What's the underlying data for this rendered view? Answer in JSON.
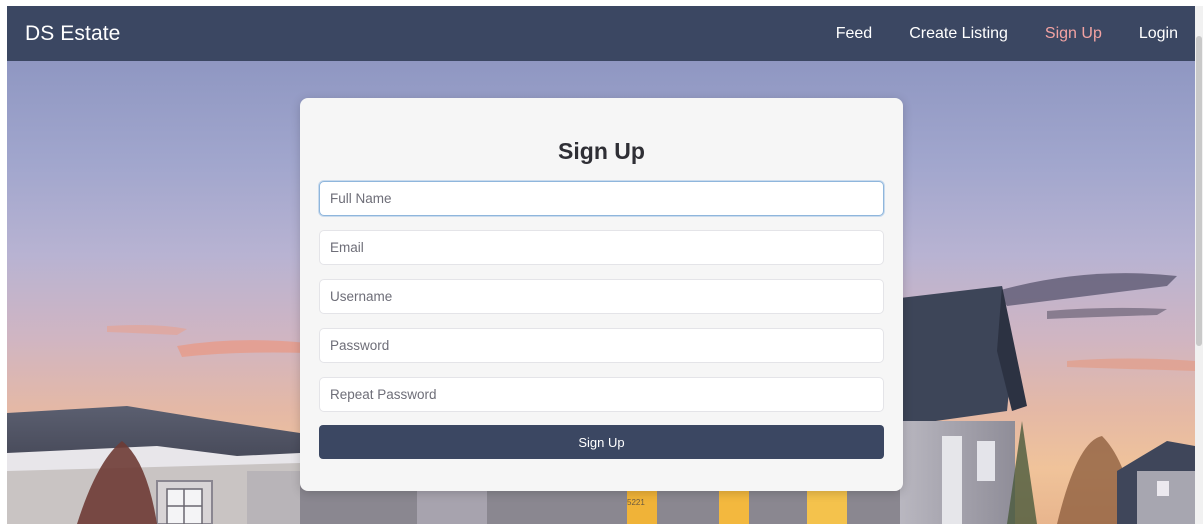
{
  "navbar": {
    "brand": "DS Estate",
    "links": [
      {
        "label": "Feed"
      },
      {
        "label": "Create Listing"
      },
      {
        "label": "Sign Up"
      },
      {
        "label": "Login"
      }
    ],
    "active_link": "Sign Up",
    "background_color": "#3b4762",
    "active_color": "#f3a3a3"
  },
  "signup": {
    "title": "Sign Up",
    "fields": [
      {
        "placeholder": "Full Name",
        "value": ""
      },
      {
        "placeholder": "Email",
        "value": ""
      },
      {
        "placeholder": "Username",
        "value": ""
      },
      {
        "placeholder": "Password",
        "value": ""
      },
      {
        "placeholder": "Repeat Password",
        "value": ""
      }
    ],
    "focused_field": "Full Name",
    "submit_label": "Sign Up",
    "button_color": "#3b4762"
  },
  "hero": {
    "house_number": "5221"
  }
}
